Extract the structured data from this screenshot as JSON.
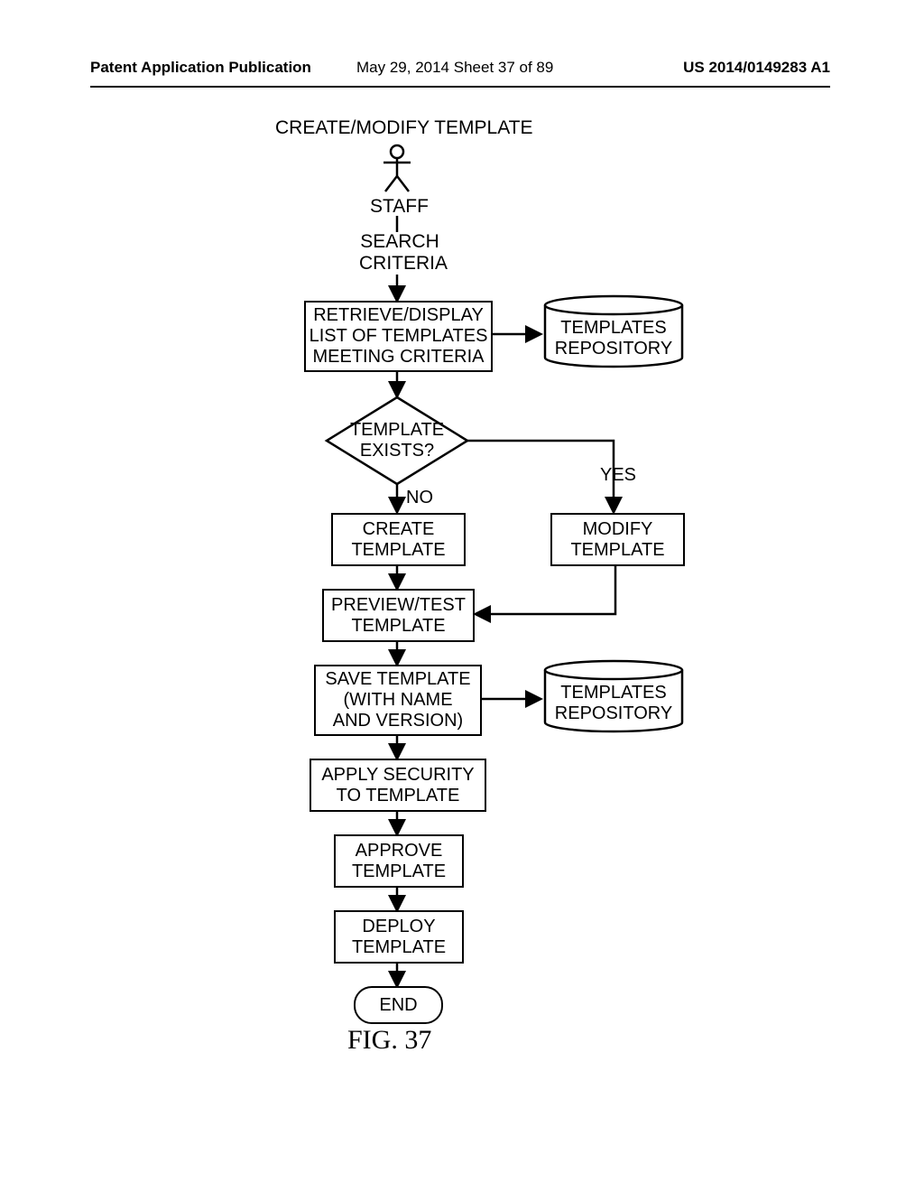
{
  "header": {
    "left": "Patent Application Publication",
    "mid": "May 29, 2014  Sheet 37 of 89",
    "right": "US 2014/0149283 A1"
  },
  "diagram": {
    "title": "CREATE/MODIFY TEMPLATE",
    "actor": "STAFF",
    "search": "SEARCH\nCRITERIA",
    "retrieve": "RETRIEVE/DISPLAY\nLIST OF TEMPLATES\nMEETING CRITERIA",
    "repo1": "TEMPLATES\nREPOSITORY",
    "decision": "TEMPLATE\nEXISTS?",
    "no": "NO",
    "yes": "YES",
    "create": "CREATE\nTEMPLATE",
    "modify": "MODIFY\nTEMPLATE",
    "preview": "PREVIEW/TEST\nTEMPLATE",
    "save": "SAVE TEMPLATE\n(WITH NAME\nAND VERSION)",
    "repo2": "TEMPLATES\nREPOSITORY",
    "security": "APPLY SECURITY\nTO TEMPLATE",
    "approve": "APPROVE\nTEMPLATE",
    "deploy": "DEPLOY\nTEMPLATE",
    "end": "END",
    "figure": "FIG. 37"
  }
}
